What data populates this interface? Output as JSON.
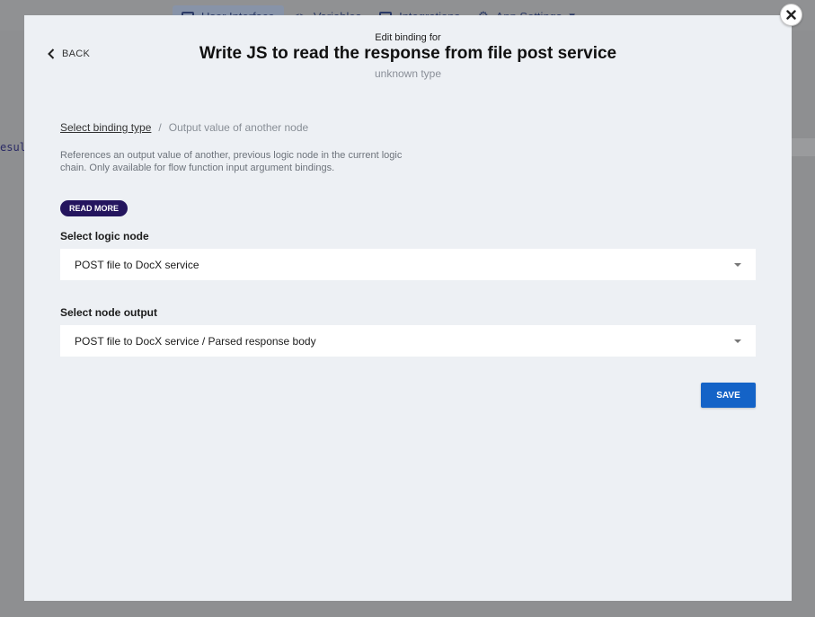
{
  "background": {
    "tabs": [
      {
        "label": "User Interface",
        "icon": "monitor-icon",
        "active": true
      },
      {
        "label": "Variables",
        "icon": "code-icon",
        "active": false
      },
      {
        "label": "Integrations",
        "icon": "database-icon",
        "active": false
      },
      {
        "label": "App Settings",
        "icon": "gear-icon",
        "active": false
      }
    ],
    "code_fragment": "esul"
  },
  "modal": {
    "back_label": "BACK",
    "header_sub": "Edit binding for",
    "title": "Write JS to read the response from file post service",
    "type": "unknown type",
    "breadcrumb": {
      "link": "Select binding type",
      "separator": "/",
      "current": "Output value of another node"
    },
    "description": "References an output value of another, previous logic node in the current logic chain. Only available for flow function input argument bindings.",
    "read_more_label": "READ MORE",
    "logic_node": {
      "label": "Select logic node",
      "value": "POST file to DocX service"
    },
    "node_output": {
      "label": "Select node output",
      "value": "POST file to DocX service / Parsed response body"
    },
    "save_label": "SAVE"
  },
  "colors": {
    "accent": "#1463c7",
    "read_more_bg": "#24155e",
    "modal_bg": "#edf0f4",
    "overlay": "#8e8f91"
  }
}
